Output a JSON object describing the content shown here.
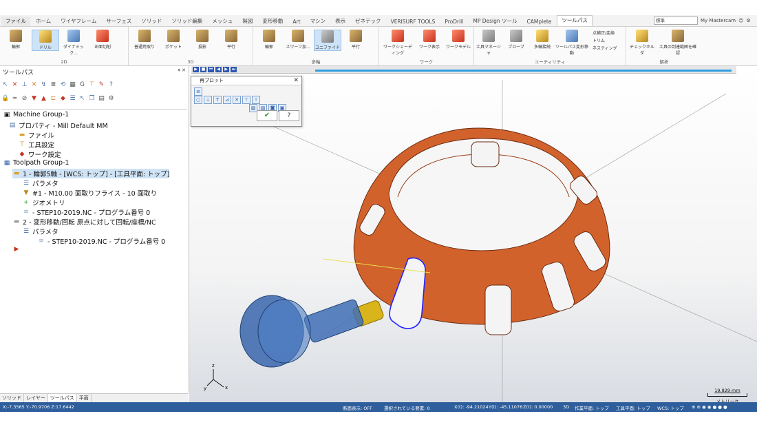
{
  "ribbon_tabs": [
    "ファイル",
    "ホーム",
    "ワイヤフレーム",
    "サーフェス",
    "ソリッド",
    "ソリッド編集",
    "メッシュ",
    "製図",
    "変形移動",
    "Art",
    "マシン",
    "表示",
    "ゼネテック",
    "VERISURF TOOLS",
    "ProDrill",
    "MP Design ツール",
    "CAMplete",
    "ツールパス"
  ],
  "active_tab": "ツールパス",
  "title_controls": {
    "mode_select": "標準",
    "account": "My Mastercam"
  },
  "groups": {
    "2d": {
      "label": "2D",
      "buttons": [
        "輪郭",
        "ドリル",
        "ダイナミック...",
        "正面切削"
      ]
    },
    "3d": {
      "label": "3D",
      "buttons": [
        "普通荒取り",
        "ポケット",
        "投影",
        "平行"
      ]
    },
    "multiaxis": {
      "label": "多軸",
      "buttons": [
        "輪郭",
        "スワーフ加...",
        "ユニファイド",
        "平行"
      ]
    },
    "work": {
      "label": "ワーク",
      "buttons": [
        "ワークシェーディング",
        "ワーク表示",
        "ワークモデル"
      ]
    },
    "utility": {
      "label": "ユーティリティ",
      "buttons": [
        "工具マネージャ",
        "プローブ",
        "多軸接続",
        "ツールパス変形移動"
      ],
      "small": [
        "点補正/変換",
        "トリム",
        "ネスティング"
      ]
    },
    "analysis": {
      "label": "解析",
      "buttons": [
        "チェックホルダ",
        "工具の到達範囲を確認"
      ]
    }
  },
  "panel": {
    "title": "ツールパス",
    "controls": "▾ ✕"
  },
  "tree": [
    {
      "label": "Machine Group-1",
      "level": 0,
      "icon": "machine-icon"
    },
    {
      "label": "プロパティ - Mill Default MM",
      "level": 1,
      "icon": "properties-icon"
    },
    {
      "label": "ファイル",
      "level": 2,
      "icon": "folder-icon"
    },
    {
      "label": "工具設定",
      "level": 2,
      "icon": "tool-settings-icon"
    },
    {
      "label": "ワーク設定",
      "level": 2,
      "icon": "stock-icon"
    },
    {
      "label": "Toolpath Group-1",
      "level": 0,
      "icon": "toolpath-group-icon"
    },
    {
      "label": "1 - 輪郭5軸 - [WCS: トップ] - [工具平面: トップ]",
      "level": 1,
      "icon": "operation-folder-icon",
      "selected": true
    },
    {
      "label": "パラメタ",
      "level": 2,
      "icon": "parameters-icon"
    },
    {
      "label": "#1 - M10.00 面取りフライス - 10 面取り",
      "level": 2,
      "icon": "tool-icon"
    },
    {
      "label": "ジオメトリ",
      "level": 2,
      "icon": "geometry-icon"
    },
    {
      "label": "- STEP10-2019.NC - プログラム番号 0",
      "level": 2,
      "icon": "nc-file-icon"
    },
    {
      "label": "2 - 変形移動/回転 原点に対して回転/座標/NC",
      "level": 1,
      "icon": "operation-folder-icon"
    },
    {
      "label": "パラメタ",
      "level": 2,
      "icon": "parameters-icon"
    },
    {
      "label": "- STEP10-2019.NC - プログラム番号 0",
      "level": 2,
      "icon": "nc-file-icon"
    },
    {
      "label": "",
      "level": 1,
      "icon": "insert-arrow-icon"
    }
  ],
  "bottom_tabs": [
    "ソリッド",
    "レイヤー",
    "ツールパス",
    "平面"
  ],
  "backplot_dialog": {
    "title": "再プロット",
    "ok": "✔",
    "help": "?"
  },
  "scale": {
    "value": "19.829 mm",
    "unit": "メトリック"
  },
  "statusbar": {
    "coords_left": "X:-7.3565  Y:-70.9706  Z:17.6442",
    "section_view": "断面表示: OFF",
    "selected": "選択されている要素: 0",
    "x": "X(t): -94.21024",
    "y": "Y(t): -45.11076",
    "z": "Z(t): 0.00000",
    "mode": "3D",
    "plane": "作業平面: トップ",
    "tool_plane": "工具平面: トップ",
    "wcs": "WCS: トップ"
  },
  "colors": {
    "part": "#d2622c",
    "status_bar": "#2e5e9b",
    "tool_blue": "#2b5fa8",
    "selection": "#2222ff"
  }
}
